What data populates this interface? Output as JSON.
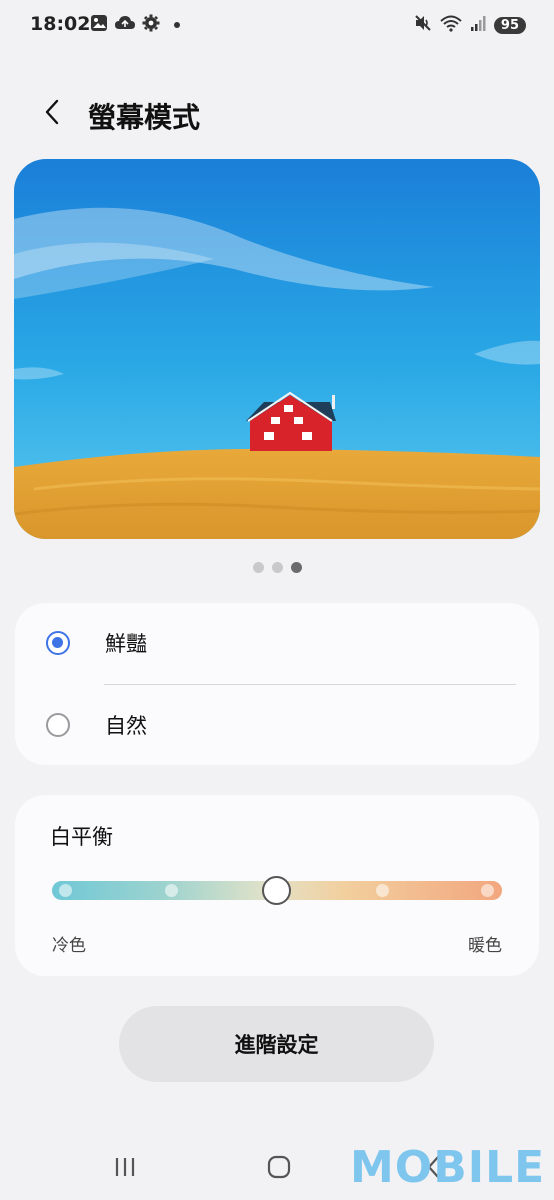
{
  "status_bar": {
    "time": "18:02",
    "battery": "95",
    "left_icons": [
      "gallery-icon",
      "cloud-sync-icon",
      "settings-icon",
      "dot-icon"
    ],
    "right_icons": [
      "mute-icon",
      "wifi-icon",
      "signal-icon"
    ]
  },
  "header": {
    "title": "螢幕模式"
  },
  "preview": {
    "page_count": 3,
    "active_page": 3
  },
  "mode": {
    "options": [
      {
        "label": "鮮豔",
        "selected": true
      },
      {
        "label": "自然",
        "selected": false
      }
    ]
  },
  "white_balance": {
    "title": "白平衡",
    "cool_label": "冷色",
    "warm_label": "暖色",
    "level": 0.5,
    "steps": 5
  },
  "advanced_button": {
    "label": "進階設定"
  },
  "watermark": {
    "text": "MOBILE"
  },
  "colors": {
    "accent": "#3e74e6",
    "background": "#f2f2f4",
    "card": "#fbfbfd"
  }
}
